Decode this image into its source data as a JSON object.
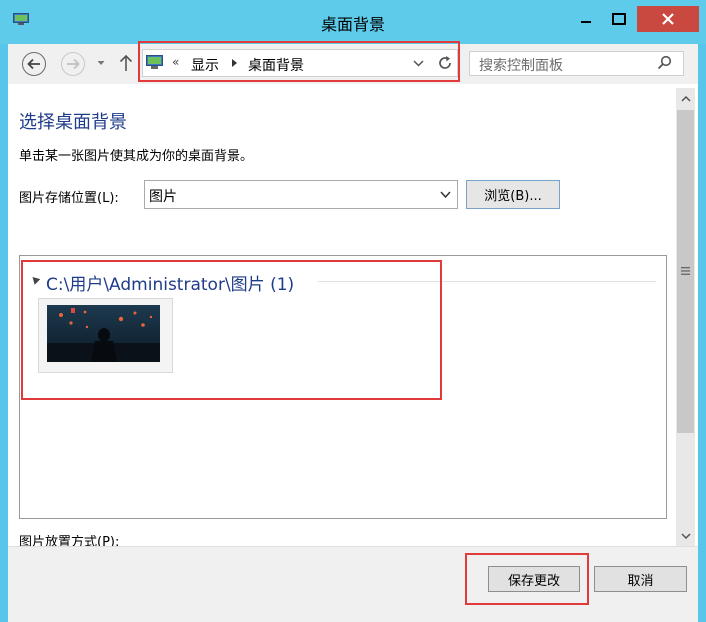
{
  "window": {
    "title": "桌面背景",
    "controls": [
      "minimize-icon",
      "maximize-icon",
      "close-icon"
    ]
  },
  "nav": {
    "breadcrumb_prefix": "«",
    "breadcrumb": [
      "显示",
      "桌面背景"
    ],
    "search_placeholder": "搜索控制面板"
  },
  "content": {
    "heading": "选择桌面背景",
    "description": "单击某一张图片使其成为你的桌面背景。",
    "location_label": "图片存储位置(L):",
    "location_value": "图片",
    "browse_label": "浏览(B)...",
    "group_title": "C:\\用户\\Administrator\\图片 (1)",
    "position_label": "图片放置方式(P):"
  },
  "footer": {
    "save_label": "保存更改",
    "cancel_label": "取消"
  },
  "colors": {
    "titlebar": "#5ecbea",
    "close_button": "#c9483f",
    "heading": "#1f3c8a",
    "highlight": "#e03a3a"
  }
}
